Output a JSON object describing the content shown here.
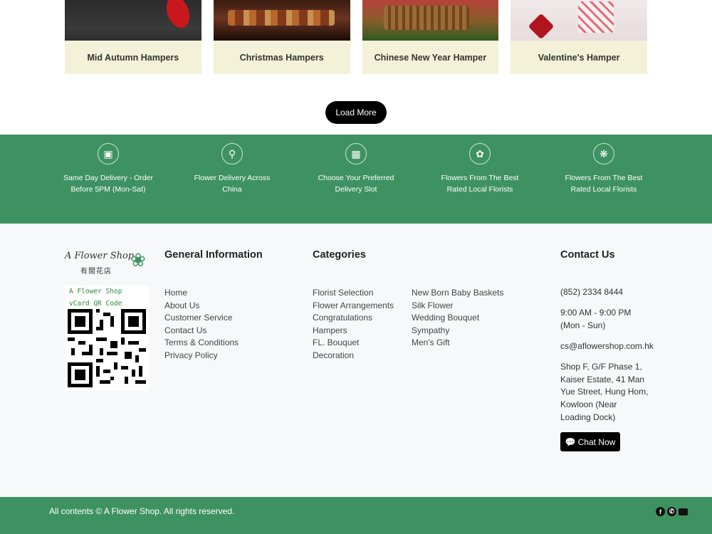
{
  "products": [
    {
      "label": "Mid Autumn Hampers"
    },
    {
      "label": "Christmas Hampers"
    },
    {
      "label": "Chinese New Year Hamper"
    },
    {
      "label": "Valentine's Hamper"
    }
  ],
  "load_more_label": "Load More",
  "features": [
    {
      "icon": "delivery-truck-icon",
      "text": "Same Day Delivery - Order Before 5PM (Mon-Sat)"
    },
    {
      "icon": "location-pin-icon",
      "text": "Flower Delivery Across China"
    },
    {
      "icon": "calendar-icon",
      "text": "Choose Your Preferred Delivery Slot"
    },
    {
      "icon": "flower-hand-icon",
      "text": "Flowers From The Best Rated Local Florists"
    },
    {
      "icon": "flower-icon",
      "text": "Flowers From The Best Rated Local Florists"
    }
  ],
  "brand": {
    "logo_script": "A Flower Shop",
    "logo_cn": "有間花店",
    "qr_line1": "A Flower Shop",
    "qr_line2": "vCard QR Code"
  },
  "general_info": {
    "title": "General Information",
    "links": [
      "Home",
      "About Us",
      "Customer Service",
      "Contact Us",
      "Terms & Conditions",
      "Privacy Policy"
    ]
  },
  "categories": {
    "title": "Categories",
    "col1": [
      "Florist Selection",
      "Flower Arrangements",
      "Congratulations",
      "Hampers",
      "FL. Bouquet",
      "Decoration"
    ],
    "col2": [
      "New Born Baby Baskets",
      "Silk Flower",
      "Wedding Bouquet",
      "Sympathy",
      "Men's Gift"
    ]
  },
  "contact": {
    "title": "Contact Us",
    "phone": "(852) 2334 8444",
    "hours_line1": "9:00 AM - 9:00 PM",
    "hours_line2": "(Mon - Sun)",
    "email": "cs@aflowershop.com.hk",
    "addr1": "Shop F, G/F Phase 1,",
    "addr2": "Kaiser Estate, 41 Man",
    "addr3": "Yue Street, Hung Hom,",
    "addr4": "Kowloon (Near",
    "addr5": "Loading Dock)",
    "chat_label": "Chat Now"
  },
  "copyright": "All contents © A Flower Shop. All rights reserved.",
  "social_icons": [
    "facebook-icon",
    "whatsapp-icon",
    "email-icon"
  ],
  "colors": {
    "brand_green": "#3e9261",
    "card_caption_bg": "#f3f1d8",
    "footer_bg": "#f7f8fa"
  }
}
